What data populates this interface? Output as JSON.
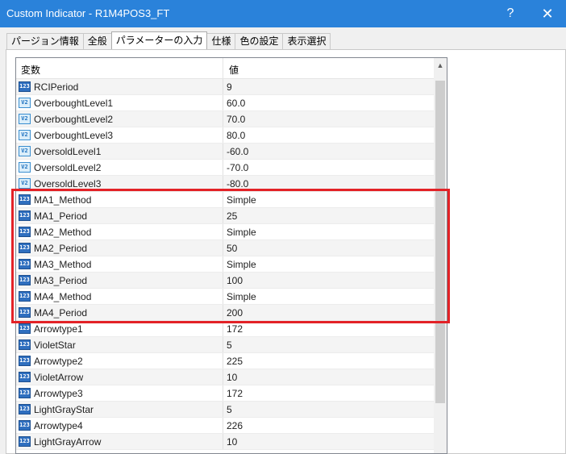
{
  "window": {
    "title": "Custom Indicator - R1M4POS3_FT",
    "help_glyph": "?",
    "close_glyph": "✕"
  },
  "tabs": [
    {
      "label": "パージョン情報"
    },
    {
      "label": "全般"
    },
    {
      "label": "パラメーターの入力"
    },
    {
      "label": "仕様"
    },
    {
      "label": "色の設定"
    },
    {
      "label": "表示選択"
    }
  ],
  "grid": {
    "header_variable": "変数",
    "header_value": "値",
    "rows": [
      {
        "name": "RCIPeriod",
        "value": "9",
        "icon": "int-icon"
      },
      {
        "name": "OverboughtLevel1",
        "value": "60.0",
        "icon": "double-icon"
      },
      {
        "name": "OverboughtLevel2",
        "value": "70.0",
        "icon": "double-icon"
      },
      {
        "name": "OverboughtLevel3",
        "value": "80.0",
        "icon": "double-icon"
      },
      {
        "name": "OversoldLevel1",
        "value": "-60.0",
        "icon": "double-icon"
      },
      {
        "name": "OversoldLevel2",
        "value": "-70.0",
        "icon": "double-icon"
      },
      {
        "name": "OversoldLevel3",
        "value": "-80.0",
        "icon": "double-icon"
      },
      {
        "name": "MA1_Method",
        "value": "Simple",
        "icon": "int-icon"
      },
      {
        "name": "MA1_Period",
        "value": "25",
        "icon": "int-icon"
      },
      {
        "name": "MA2_Method",
        "value": "Simple",
        "icon": "int-icon"
      },
      {
        "name": "MA2_Period",
        "value": "50",
        "icon": "int-icon"
      },
      {
        "name": "MA3_Method",
        "value": "Simple",
        "icon": "int-icon"
      },
      {
        "name": "MA3_Period",
        "value": "100",
        "icon": "int-icon"
      },
      {
        "name": "MA4_Method",
        "value": "Simple",
        "icon": "int-icon"
      },
      {
        "name": "MA4_Period",
        "value": "200",
        "icon": "int-icon"
      },
      {
        "name": "Arrowtype1",
        "value": "172",
        "icon": "int-icon"
      },
      {
        "name": "VioletStar",
        "value": "5",
        "icon": "int-icon"
      },
      {
        "name": "Arrowtype2",
        "value": "225",
        "icon": "int-icon"
      },
      {
        "name": "VioletArrow",
        "value": "10",
        "icon": "int-icon"
      },
      {
        "name": "Arrowtype3",
        "value": "172",
        "icon": "int-icon"
      },
      {
        "name": "LightGrayStar",
        "value": "5",
        "icon": "int-icon"
      },
      {
        "name": "Arrowtype4",
        "value": "226",
        "icon": "int-icon"
      },
      {
        "name": "LightGrayArrow",
        "value": "10",
        "icon": "int-icon"
      }
    ]
  },
  "scrollbar": {
    "up_glyph": "▲"
  },
  "colors": {
    "titlebar": "#2a82da",
    "highlight": "#e32227"
  }
}
